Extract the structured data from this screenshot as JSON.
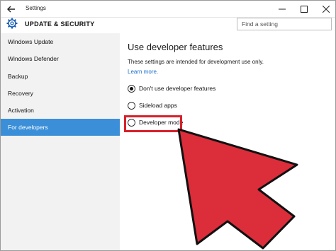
{
  "window": {
    "title": "Settings",
    "back_icon": "back-arrow-icon",
    "minimize_icon": "minimize-icon",
    "maximize_icon": "maximize-icon",
    "close_icon": "close-icon"
  },
  "header": {
    "section_icon": "gear-icon",
    "section_title": "UPDATE & SECURITY",
    "search_placeholder": "Find a setting",
    "search_icon": "search-icon"
  },
  "sidebar": {
    "items": [
      {
        "label": "Windows Update"
      },
      {
        "label": "Windows Defender"
      },
      {
        "label": "Backup"
      },
      {
        "label": "Recovery"
      },
      {
        "label": "Activation"
      },
      {
        "label": "For developers"
      }
    ],
    "active_index": 5
  },
  "main": {
    "title": "Use developer features",
    "description": "These settings are intended for development use only.",
    "learn_more": "Learn more.",
    "options": [
      {
        "label": "Don't use developer features",
        "selected": true
      },
      {
        "label": "Sideload apps",
        "selected": false
      },
      {
        "label": "Developer mode",
        "selected": false
      }
    ]
  },
  "annotation": {
    "highlight_color": "#d8202a",
    "arrow_color": "#dc2d3a",
    "arrow_icon": "pointer-arrow-icon"
  },
  "colors": {
    "accent": "#3a8fd8",
    "sidebar_bg": "#f2f2f2",
    "link": "#1a6fcc"
  }
}
